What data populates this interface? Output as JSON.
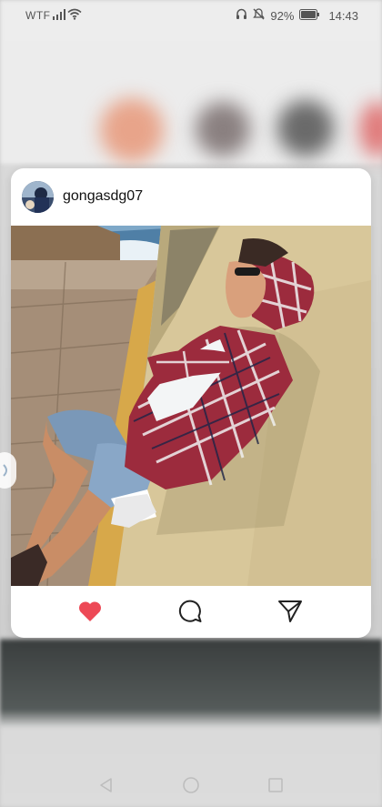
{
  "status_bar": {
    "carrier": "WTF",
    "battery": "92%",
    "time": "14:43"
  },
  "post": {
    "username": "gongasdg07"
  },
  "icons": {
    "like": "heart-icon",
    "comment": "comment-icon",
    "share": "send-icon"
  },
  "colors": {
    "heart": "#ed4956",
    "card": "#ffffff"
  },
  "nav": {
    "back": "back-icon",
    "home": "home-icon",
    "recents": "recents-icon"
  }
}
